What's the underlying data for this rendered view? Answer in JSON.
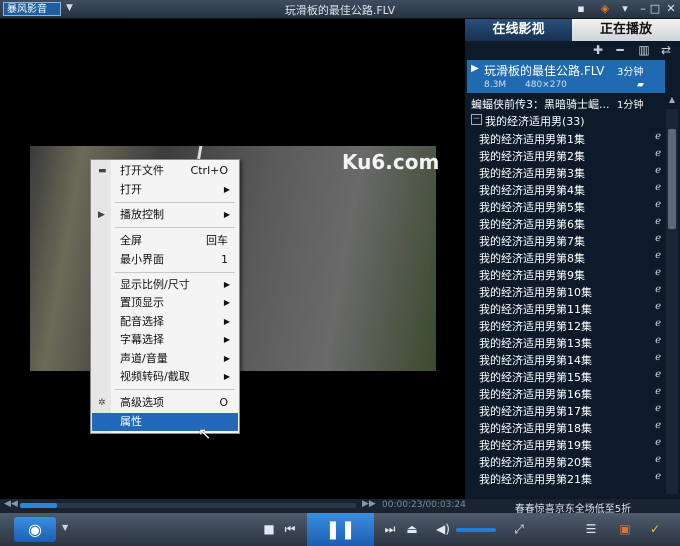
{
  "app": {
    "logo_text": "暴风影音",
    "window_title": "玩滑板的最佳公路.FLV"
  },
  "video": {
    "watermark": "Ku6.com"
  },
  "context_menu": {
    "items": [
      {
        "label": "打开文件",
        "shortcut": "Ctrl+O",
        "icon": "open-file-icon"
      },
      {
        "label": "打开",
        "submenu": true
      },
      {
        "label": "播放控制",
        "submenu": true,
        "icon": "play-icon"
      },
      {
        "label": "全屏",
        "shortcut": "回车"
      },
      {
        "label": "最小界面",
        "shortcut": "1"
      },
      {
        "label": "显示比例/尺寸",
        "submenu": true
      },
      {
        "label": "置顶显示",
        "submenu": true
      },
      {
        "label": "配音选择",
        "submenu": true
      },
      {
        "label": "字幕选择",
        "submenu": true
      },
      {
        "label": "声道/音量",
        "submenu": true
      },
      {
        "label": "视频转码/截取",
        "submenu": true
      },
      {
        "label": "高级选项",
        "shortcut": "O",
        "icon": "gear-icon"
      },
      {
        "label": "属性",
        "selected": true
      }
    ]
  },
  "panel": {
    "tab_online": "在线影视",
    "tab_playing": "正在播放",
    "now_playing": {
      "title": "玩滑板的最佳公路.FLV",
      "duration": "3分钟",
      "size": "8.3M",
      "resolution": "480×270"
    },
    "second_item": {
      "title": "蝙蝠侠前传3：黑暗骑士崛...",
      "duration": "1分钟"
    },
    "group": {
      "title": "我的经济适用男(33)"
    },
    "episodes": [
      "我的经济适用男第1集",
      "我的经济适用男第2集",
      "我的经济适用男第3集",
      "我的经济适用男第4集",
      "我的经济适用男第5集",
      "我的经济适用男第6集",
      "我的经济适用男第7集",
      "我的经济适用男第8集",
      "我的经济适用男第9集",
      "我的经济适用男第10集",
      "我的经济适用男第11集",
      "我的经济适用男第12集",
      "我的经济适用男第13集",
      "我的经济适用男第14集",
      "我的经济适用男第15集",
      "我的经济适用男第16集",
      "我的经济适用男第17集",
      "我的经济适用男第18集",
      "我的经济适用男第19集",
      "我的经济适用男第20集",
      "我的经济适用男第21集"
    ]
  },
  "playback": {
    "time": "00:00:23/00:03:24",
    "progress": 0.11,
    "ad_text": "春春惊喜京东全场低至5折"
  }
}
